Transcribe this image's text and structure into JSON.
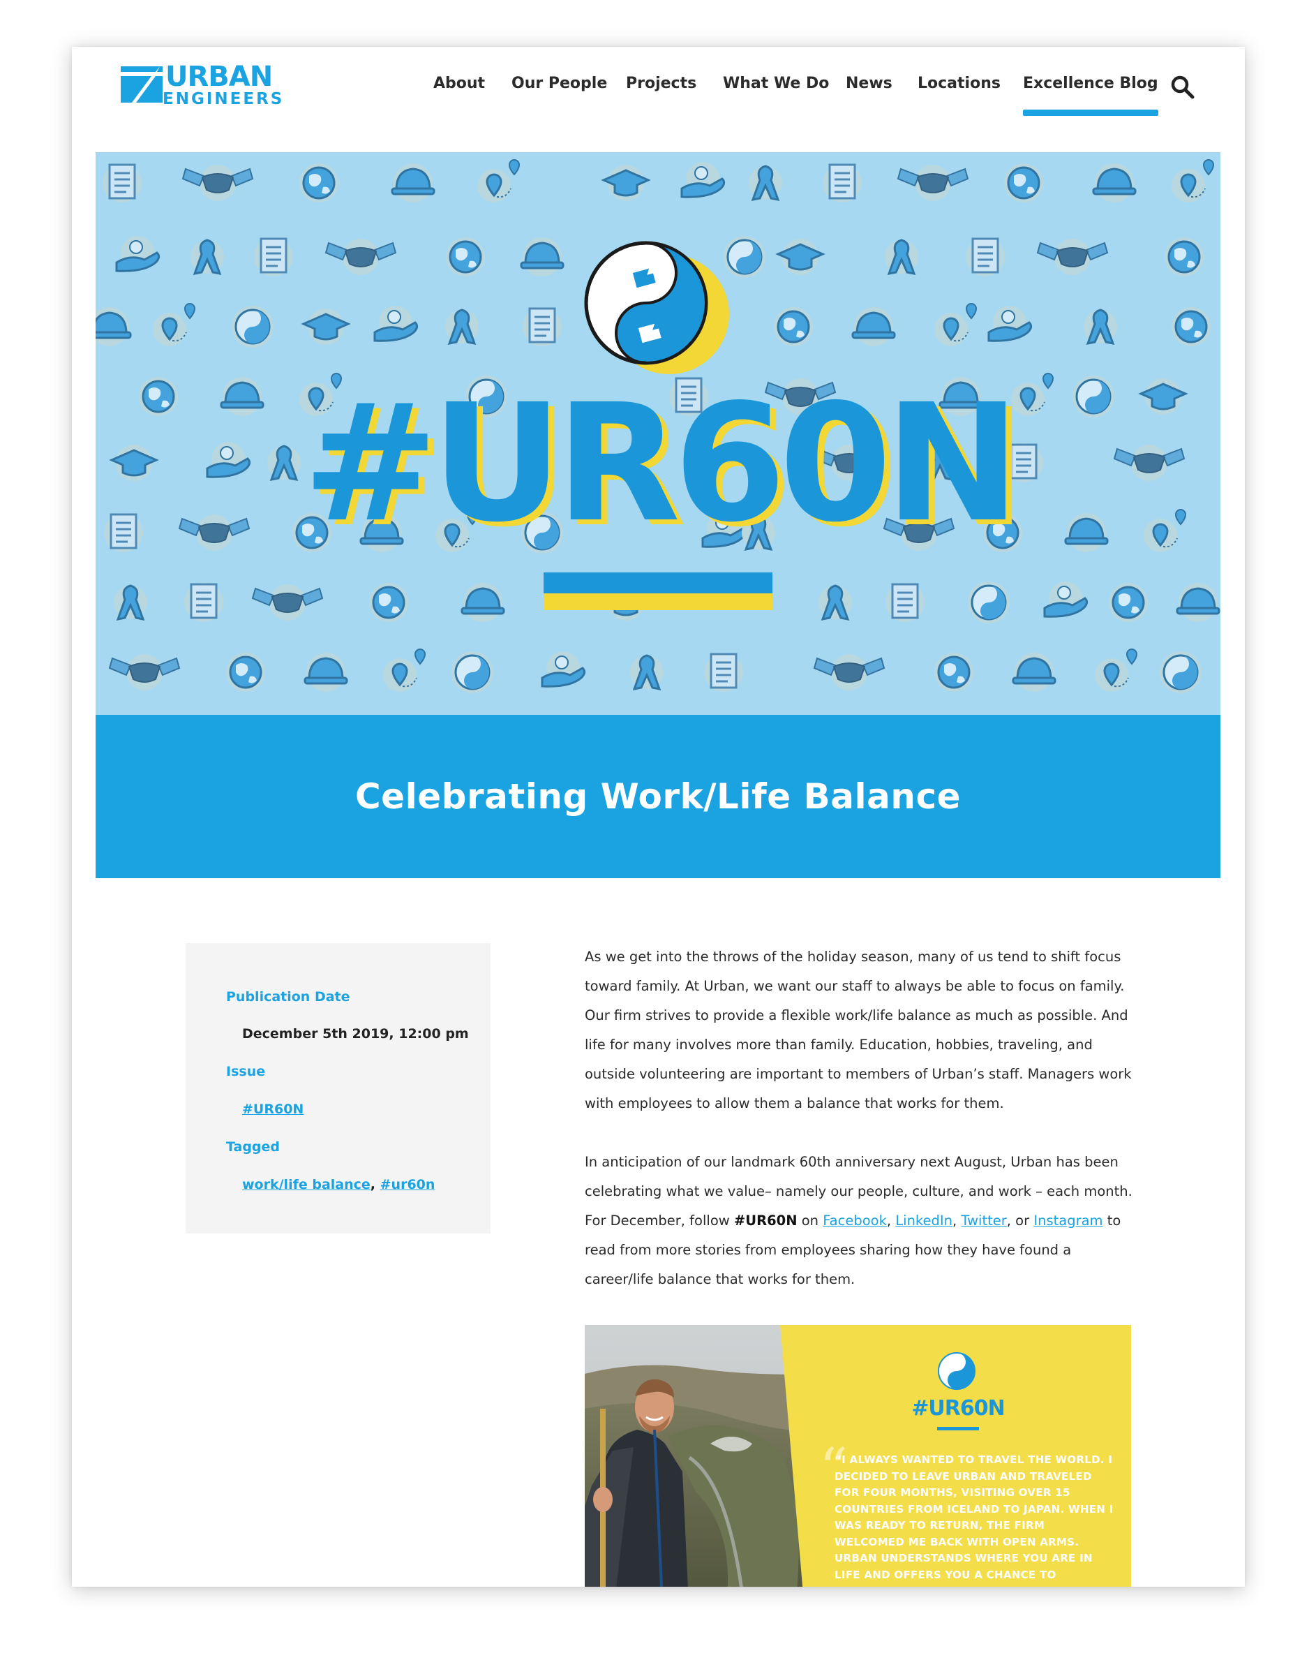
{
  "brand": {
    "logo_line1": "URBAN",
    "logo_line2": "ENGINEERS",
    "accent_color": "#1aa3e0",
    "secondary_color": "#f2d735"
  },
  "nav": {
    "items": [
      {
        "label": "About"
      },
      {
        "label": "Our People"
      },
      {
        "label": "Projects"
      },
      {
        "label": "What We Do"
      },
      {
        "label": "News"
      },
      {
        "label": "Locations"
      },
      {
        "label": "Excellence Blog",
        "active": true
      }
    ],
    "search_icon": "search-icon"
  },
  "hero": {
    "hashtag": "#UR60N",
    "pattern_icons": [
      "document-icon",
      "handshake-icon",
      "globe-icon",
      "hardhat-icon",
      "location-pin-icon",
      "graduation-cap-icon",
      "ribbon-icon",
      "yin-yang-icon",
      "hand-icon"
    ]
  },
  "article": {
    "title": "Celebrating Work/Life Balance",
    "paragraph1": "As we get into the throws of the holiday season, many of us tend to shift focus toward family. At Urban, we want our staff to always be able to focus on family. Our firm strives to provide a flexible work/life balance as much as possible. And life for many involves more than family. Education, hobbies, traveling, and outside volunteering are important to members of Urban’s staff. Managers work with employees to allow them a balance that works for them.",
    "paragraph2": {
      "part1": "In anticipation of our landmark 60th anniversary next August, Urban has been celebrating what we value– namely our people, culture, and work – each month. For December, follow ",
      "hashtag": "#UR60N",
      "part2": " on ",
      "link_facebook": "Facebook",
      "sep1": ", ",
      "link_linkedin": "LinkedIn",
      "sep2": ", ",
      "link_twitter": "Twitter",
      "sep3": ", or ",
      "link_instagram": "Instagram",
      "part3": " to read from more stories from employees sharing how they have found a career/life balance that works for them."
    }
  },
  "meta": {
    "publication_label": "Publication Date",
    "publication_value": "December 5th 2019, 12:00 pm",
    "issue_label": "Issue",
    "issue_value": "#UR60N",
    "tagged_label": "Tagged",
    "tags": [
      "work/life balance",
      "#ur60n"
    ],
    "tag_separator": ","
  },
  "feature": {
    "hashtag": "#UR60N",
    "quote": "“I always wanted to travel the world. I decided to leave Urban and traveled for four months, visiting over 15 countries from Iceland to Japan. When I was ready to return, the firm welcomed me back with open arms. Urban understands where you are in life and offers you a chance to balance what is most important.”"
  }
}
